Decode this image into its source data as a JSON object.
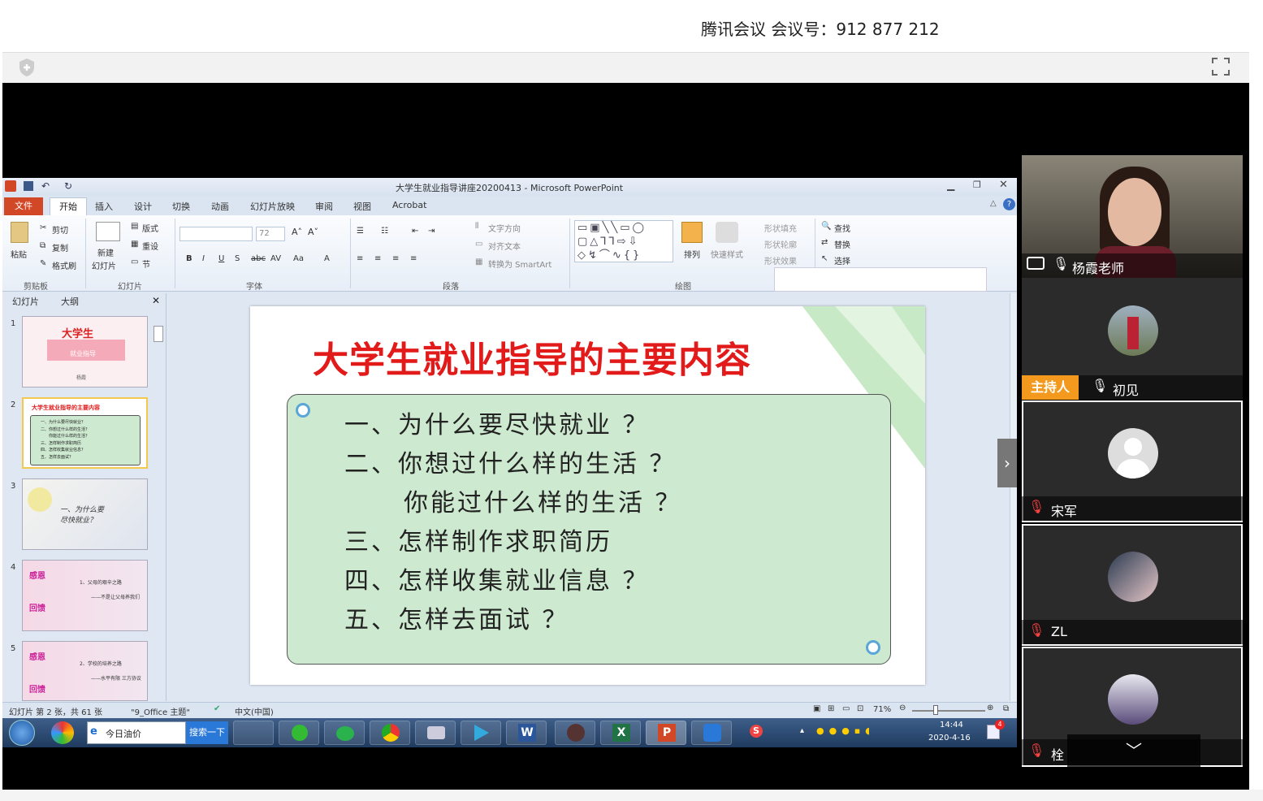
{
  "meeting": {
    "title": "腾讯会议 会议号：912 877 212"
  },
  "ppt": {
    "window_title": "大学生就业指导讲座20200413  -  Microsoft PowerPoint",
    "tabs": [
      "文件",
      "开始",
      "插入",
      "设计",
      "切换",
      "动画",
      "幻灯片放映",
      "审阅",
      "视图",
      "Acrobat"
    ],
    "ribbon": {
      "clipboard": {
        "paste": "粘贴",
        "cut": "剪切",
        "copy": "复制",
        "format_painter": "格式刷",
        "group": "剪贴板"
      },
      "slides": {
        "new_slide": "新建",
        "new_slide2": "幻灯片",
        "layout": "版式",
        "reset": "重设",
        "section": "节",
        "group": "幻灯片"
      },
      "font": {
        "size": "72",
        "group": "字体"
      },
      "paragraph": {
        "text_direction": "文字方向",
        "align_text": "对齐文本",
        "smartart": "转换为 SmartArt",
        "group": "段落"
      },
      "drawing": {
        "arrange": "排列",
        "quick_styles": "快速样式",
        "fill": "形状填充",
        "outline": "形状轮廓",
        "effects": "形状效果",
        "group": "绘图"
      },
      "editing": {
        "find": "查找",
        "replace": "替换",
        "select": "选择"
      }
    },
    "pane_tabs": {
      "slides": "幻灯片",
      "outline": "大纲"
    },
    "thumbs": {
      "t1": {
        "title": "大学生",
        "sub": "就业指导",
        "foot": "杨霞"
      },
      "t2": {
        "title": "大学生就业指导的主要内容",
        "lines": [
          "一、为什么要尽快就业？",
          "二、你想过什么样的生活？",
          "你能过什么样的生活？",
          "三、怎样制作求职简历",
          "四、怎样收集就业信息？",
          "五、怎样去面试？"
        ]
      },
      "t3": {
        "text": "一、为什么要尽快就业？"
      },
      "t4": {
        "a": "感恩",
        "b": "回馈",
        "text": "1、父母的艰辛之路",
        "sub": "——不是让父母养我们"
      },
      "t5": {
        "a": "感恩",
        "b": "回馈",
        "text": "2、学校的培养之路",
        "sub": "——水平有限 三方协议"
      }
    },
    "slide": {
      "title": "大学生就业指导的主要内容",
      "lines": [
        "一、为什么要尽快就业 ？",
        "二、你想过什么样的生活 ？",
        "你能过什么样的生活 ？",
        "三、怎样制作求职简历",
        "四、怎样收集就业信息 ？",
        "五、怎样去面试 ？"
      ]
    },
    "status": {
      "slide_info": "幻灯片 第 2 张，共 61 张",
      "theme": "\"9_Office 主题\"",
      "lang": "中文(中国)",
      "zoom": "71%"
    },
    "taskbar": {
      "search_text": "今日油价",
      "search_btn": "搜索一下",
      "time": "14:44",
      "date": "2020-4-16",
      "badge": "4"
    }
  },
  "participants": [
    {
      "name": "杨霞老师",
      "role": ""
    },
    {
      "name": "初见",
      "role": "主持人"
    },
    {
      "name": "宋军",
      "role": ""
    },
    {
      "name": "ZL",
      "role": ""
    },
    {
      "name": "栓",
      "role": ""
    }
  ]
}
